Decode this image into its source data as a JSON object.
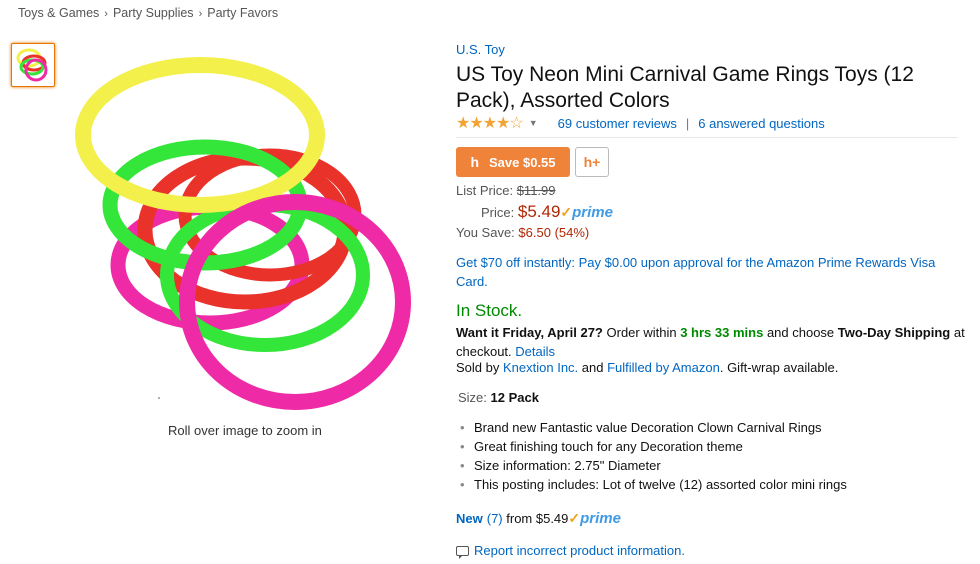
{
  "breadcrumb": {
    "items": [
      "Toys & Games",
      "Party Supplies",
      "Party Favors"
    ],
    "separator": "›"
  },
  "gallery": {
    "zoom_hint": "Roll over image to zoom in",
    "ring_colors": [
      "#f3f04b",
      "#e8322a",
      "#34e63a",
      "#ee2aa6"
    ]
  },
  "product": {
    "brand": "U.S. Toy",
    "title": "US Toy Neon Mini Carnival Game Rings Toys (12 Pack), Assorted Colors",
    "rating_stars": 4,
    "reviews": "69 customer reviews",
    "divider": "|",
    "questions": "6 answered questions"
  },
  "honey": {
    "save_label": "Save $0.55",
    "icon": "h",
    "add_icon": "h+"
  },
  "pricing": {
    "list_label": "List Price:",
    "list_value": "$11.99",
    "price_label": "Price:",
    "price_value": "$5.49",
    "prime_check": "✓",
    "prime_label": "prime",
    "save_label": "You Save:",
    "save_value": "$6.50 (54%)"
  },
  "card_offer": "Get $70 off instantly: Pay $0.00 upon approval for the Amazon Prime Rewards Visa Card.",
  "availability": {
    "stock": "In Stock.",
    "want_it": "Want it Friday, April 27?",
    "order_within": "Order within",
    "time_left": "3 hrs 33 mins",
    "and_choose": "and choose",
    "shipping": "Two-Day Shipping",
    "at_checkout": "at checkout.",
    "details": "Details",
    "sold_by_label": "Sold by",
    "seller": "Knextion Inc.",
    "and": "and",
    "fulfilled": "Fulfilled by Amazon",
    "gift_wrap": ". Gift-wrap available."
  },
  "size": {
    "label": "Size:",
    "value": "12 Pack"
  },
  "bullets": [
    "Brand new Fantastic value Decoration Clown Carnival Rings",
    "Great finishing touch for any Decoration theme",
    "Size information: 2.75\" Diameter",
    "This posting includes: Lot of twelve (12) assorted color mini rings"
  ],
  "offers": {
    "new_label": "New",
    "count": "(7)",
    "from": "from $5.49",
    "prime_check": "✓",
    "prime_label": "prime"
  },
  "report_link": "Report incorrect product information."
}
